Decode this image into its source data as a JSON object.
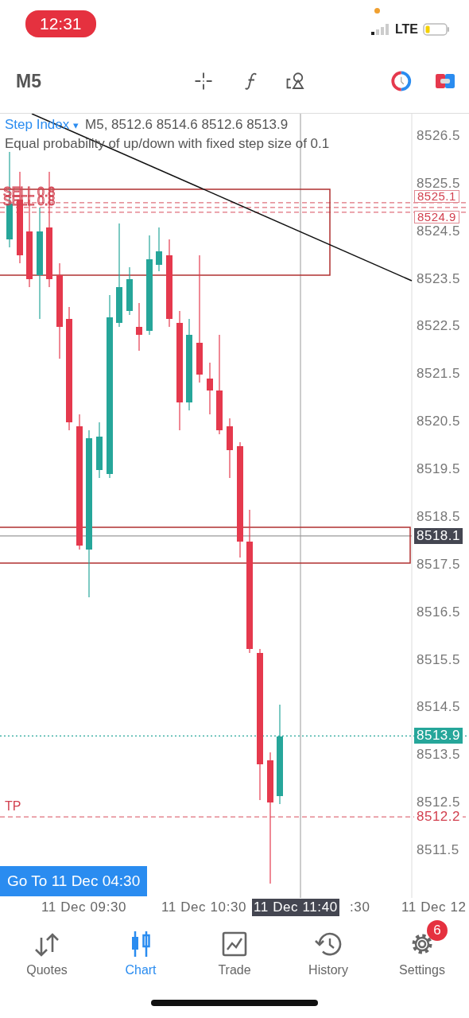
{
  "status_bar": {
    "time": "12:31",
    "network": "LTE"
  },
  "toolbar": {
    "timeframe": "M5"
  },
  "chart": {
    "symbol": "Step Index",
    "symbol_glyph": "▾",
    "ohlc": "M5, 8512.6 8514.6 8512.6 8513.9",
    "description": "Equal probability of up/down with fixed step size of 0.1",
    "price_axis": [
      "8526.5",
      "8525.5",
      "8524.5",
      "8523.5",
      "8522.5",
      "8521.5",
      "8520.5",
      "8519.5",
      "8518.5",
      "8517.5",
      "8516.5",
      "8515.5",
      "8514.5",
      "8513.5",
      "8512.5",
      "8511.5"
    ],
    "price_tags": [
      {
        "kind": "sell",
        "text": "8525.1"
      },
      {
        "kind": "sell",
        "text": "8524.9"
      },
      {
        "kind": "crosshair",
        "text": "8518.1"
      },
      {
        "kind": "bid",
        "text": "8513.9"
      },
      {
        "kind": "tp",
        "text": "8512.2"
      }
    ],
    "order_labels": [
      {
        "kind": "sell",
        "text": "SELL 0.8"
      },
      {
        "kind": "sell",
        "text": "SELL 0.8"
      },
      {
        "kind": "tp",
        "text": "TP"
      }
    ],
    "goto_button": "Go To 11 Dec 04:30",
    "time_axis": [
      "11 Dec 09:30",
      "11 Dec 10:30",
      ":30",
      "11 Dec 12"
    ],
    "crosshair_time": "11 Dec 11:40"
  },
  "tabs": [
    {
      "label": "Quotes",
      "selected": false
    },
    {
      "label": "Chart",
      "selected": true
    },
    {
      "label": "Trade",
      "selected": false
    },
    {
      "label": "History",
      "selected": false
    },
    {
      "label": "Settings",
      "selected": false,
      "badge": "6"
    }
  ]
}
